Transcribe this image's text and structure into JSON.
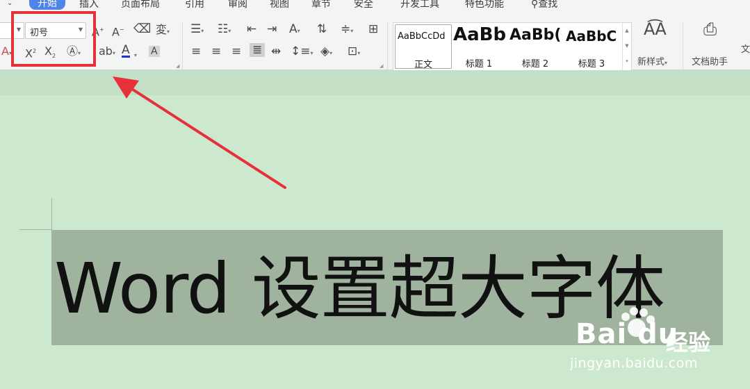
{
  "menubar": {
    "items": [
      "开始",
      "插入",
      "页面布局",
      "引用",
      "审阅",
      "视图",
      "章节",
      "安全",
      "开发工具",
      "特色功能",
      "查找"
    ],
    "active_index": 0
  },
  "ribbon": {
    "font_size_value": "初号",
    "styles": [
      {
        "preview": "AaBbCcDd",
        "name": "正文"
      },
      {
        "preview": "AaBb",
        "name": "标题 1"
      },
      {
        "preview": "AaBb(",
        "name": "标题 2"
      },
      {
        "preview": "AaBbC",
        "name": "标题 3"
      }
    ],
    "new_style_label": "新样式",
    "doc_helper_label": "文档助手",
    "cut_label": "文"
  },
  "document": {
    "selected_text_latin": "Word ",
    "selected_text_zh": "设置超大字体"
  },
  "watermark": {
    "logo": "Bai du",
    "zh": "经验",
    "url": "jingyan.baidu.com"
  },
  "colors": {
    "accent": "#4f85e8",
    "highlight_red": "#e8303a",
    "page_bg": "#cce8cf",
    "selection": "#9fb39e"
  }
}
